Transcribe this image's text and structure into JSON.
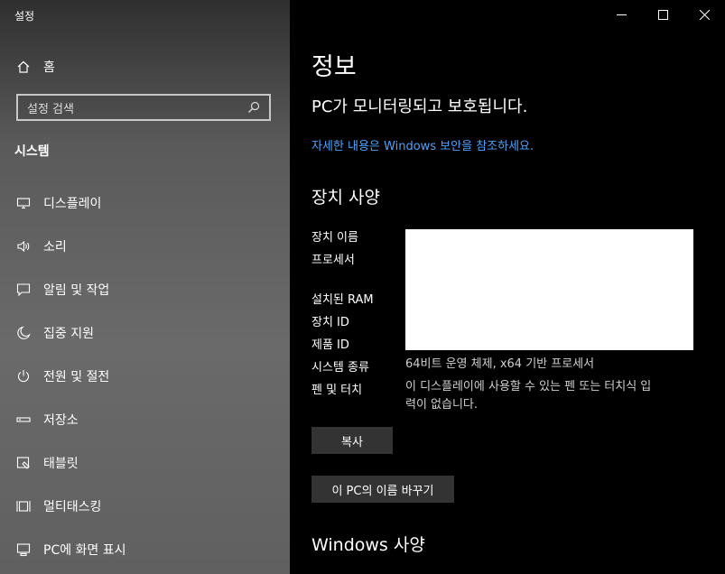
{
  "app": {
    "title": "설정"
  },
  "sidebar": {
    "home_label": "홈",
    "search_placeholder": "설정 검색",
    "section_title": "시스템",
    "items": [
      {
        "label": "디스플레이",
        "icon": "monitor-icon"
      },
      {
        "label": "소리",
        "icon": "speaker-icon"
      },
      {
        "label": "알림 및 작업",
        "icon": "notification-icon"
      },
      {
        "label": "집중 지원",
        "icon": "moon-icon"
      },
      {
        "label": "전원 및 절전",
        "icon": "power-icon"
      },
      {
        "label": "저장소",
        "icon": "storage-icon"
      },
      {
        "label": "태블릿",
        "icon": "tablet-icon"
      },
      {
        "label": "멀티태스킹",
        "icon": "multitasking-icon"
      },
      {
        "label": "PC에 화면 표시",
        "icon": "project-icon"
      }
    ]
  },
  "main": {
    "title": "정보",
    "status": "PC가 모니터링되고 보호됩니다.",
    "security_link": "자세한 내용은 Windows 보안을 참조하세요.",
    "device_spec_heading": "장치 사양",
    "specs": {
      "device_name_label": "장치 이름",
      "processor_label": "프로세서",
      "ram_label": "설치된 RAM",
      "device_id_label": "장치 ID",
      "product_id_label": "제품 ID",
      "system_type_label": "시스템 종류",
      "system_type_value": "64비트 운영 체제, x64 기반 프로세서",
      "pen_touch_label": "펜 및 터치",
      "pen_touch_value_line1": "이 디스플레이에 사용할 수 있는 펜 또는 터치식 입",
      "pen_touch_value_line2": "력이 없습니다."
    },
    "copy_button": "복사",
    "rename_button": "이 PC의 이름 바꾸기",
    "windows_spec_heading": "Windows 사양"
  },
  "colors": {
    "link": "#4aa3ff",
    "content_bg": "#000000",
    "button_bg": "#333333"
  }
}
